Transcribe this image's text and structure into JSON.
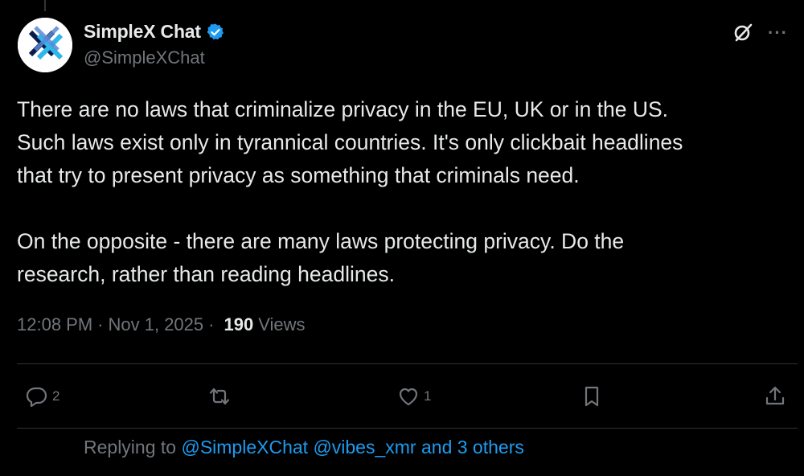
{
  "author": {
    "display_name": "SimpleX Chat",
    "handle": "@SimpleXChat",
    "verified": true,
    "verified_color": "#1d9bf0",
    "avatar_icon": "simplex-logo-icon"
  },
  "post": {
    "paragraph_1": "There are no laws that criminalize privacy in the EU, UK or in the US.\nSuch laws exist only in tyrannical countries. It's only clickbait headlines\nthat try to present privacy as something that criminals need.",
    "paragraph_2": "On the opposite - there are many laws protecting privacy. Do the\nresearch, rather than reading headlines.",
    "time": "12:08 PM",
    "date": "Nov 1, 2025",
    "separator": "·",
    "views_count": "190",
    "views_label": "Views"
  },
  "actions": {
    "reply_count": "2",
    "repost_count": "",
    "like_count": "1"
  },
  "reply_context": {
    "prefix": "Replying to",
    "mention_1": "@SimpleXChat",
    "mention_2": "@vibes_xmr",
    "suffix": "and 3 others"
  },
  "icons": {
    "header": [
      "grok-icon",
      "more-icon"
    ],
    "actions": [
      "reply-icon",
      "repost-icon",
      "like-icon",
      "bookmark-icon",
      "share-icon"
    ]
  },
  "colors": {
    "background": "#000000",
    "text": "#e7e9ea",
    "muted": "#71767b",
    "accent": "#1d9bf0",
    "divider": "#2f3336"
  }
}
